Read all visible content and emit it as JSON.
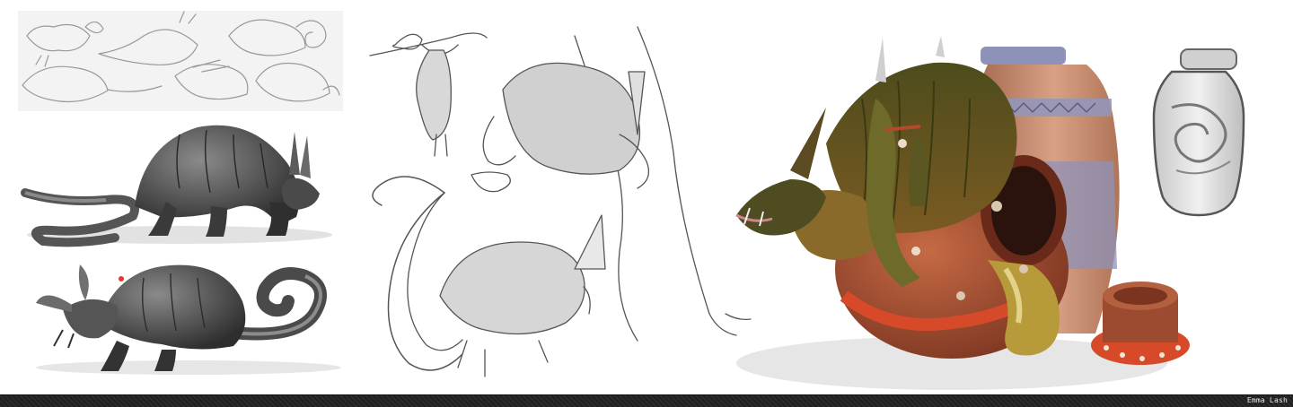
{
  "credit": {
    "artist": "Emma Lash"
  },
  "colors": {
    "background": "#ffffff",
    "footer": "#232323",
    "pot_clay": "#b0563a",
    "pot_band": "#d64a2a",
    "urn_tan": "#c98a6a",
    "urn_blue": "#8e92b8",
    "creature_green": "#5b5a22",
    "creature_brown": "#7a4a2a",
    "sketch_gray": "#9a9a9a",
    "red_dot": "#e33a2a"
  }
}
